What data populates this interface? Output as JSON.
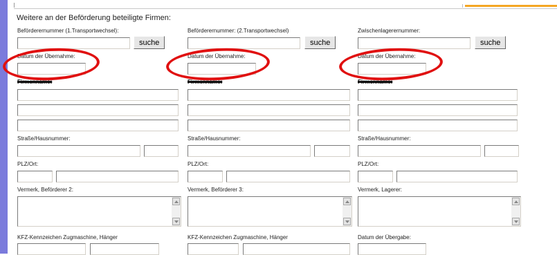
{
  "section_title": "Weitere an der Beförderung beteiligte Firmen:",
  "button_label": "suche",
  "columns": [
    {
      "id_label": "Beförderernummer (1.Transportwechsel):",
      "date_label": "Datum der Übernahme:",
      "name_label": "Firmenname:",
      "street_label": "Straße/Hausnummer:",
      "zip_label": "PLZ/Ort:",
      "note_label": "Vermerk, Beförderer 2:",
      "bottom_label": "KFZ-Kennzeichen Zugmaschine, Hänger"
    },
    {
      "id_label": "Beförderernummer: (2.Transportwechsel)",
      "date_label": "Datum der Übernahme:",
      "name_label": "Firmenname:",
      "street_label": "Straße/Hausnummer:",
      "zip_label": "PLZ/Ort:",
      "note_label": "Vermerk, Beförderer 3:",
      "bottom_label": "KFZ-Kennzeichen Zugmaschine, Hänger"
    },
    {
      "id_label": "Zwischenlagerernummer:",
      "date_label": "Datum der Übernahme:",
      "name_label": "Firmenname:",
      "street_label": "Straße/Hausnummer:",
      "zip_label": "PLZ/Ort:",
      "note_label": "Vermerk, Lagerer:",
      "bottom_label": "Datum der Übergabe:"
    }
  ],
  "colors": {
    "left_bar": "#7b7bdc",
    "highlight": "#e01010",
    "top_accent": "#f5a623"
  }
}
